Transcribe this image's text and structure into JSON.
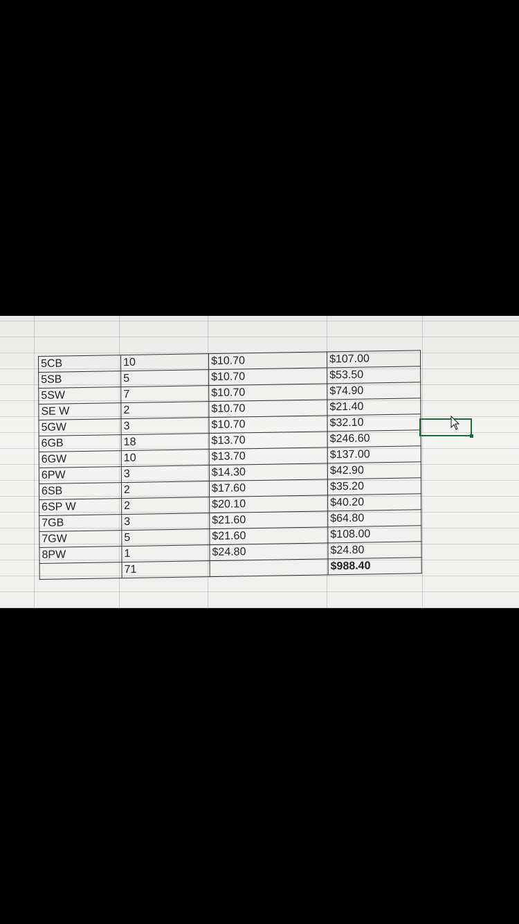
{
  "spreadsheet": {
    "rows": [
      [
        "5CB",
        "10",
        "$10.70",
        "$107.00"
      ],
      [
        "5SB",
        "5",
        "$10.70",
        "$53.50"
      ],
      [
        "5SW",
        "7",
        "$10.70",
        "$74.90"
      ],
      [
        "SE W",
        "2",
        "$10.70",
        "$21.40"
      ],
      [
        "5GW",
        "3",
        "$10.70",
        "$32.10"
      ],
      [
        "6GB",
        "18",
        "$13.70",
        "$246.60"
      ],
      [
        "6GW",
        "10",
        "$13.70",
        "$137.00"
      ],
      [
        "6PW",
        "3",
        "$14.30",
        "$42.90"
      ],
      [
        "6SB",
        "2",
        "$17.60",
        "$35.20"
      ],
      [
        "6SP W",
        "2",
        "$20.10",
        "$40.20"
      ],
      [
        "7GB",
        "3",
        "$21.60",
        "$64.80"
      ],
      [
        "7GW",
        "5",
        "$21.60",
        "$108.00"
      ],
      [
        "8PW",
        "1",
        "$24.80",
        "$24.80"
      ]
    ],
    "totals": {
      "quantity": "71",
      "amount": "$988.40"
    }
  },
  "colors": {
    "selection_border": "#1e6b35",
    "screen_background": "#f1f1ef",
    "frame_background": "#000000"
  }
}
